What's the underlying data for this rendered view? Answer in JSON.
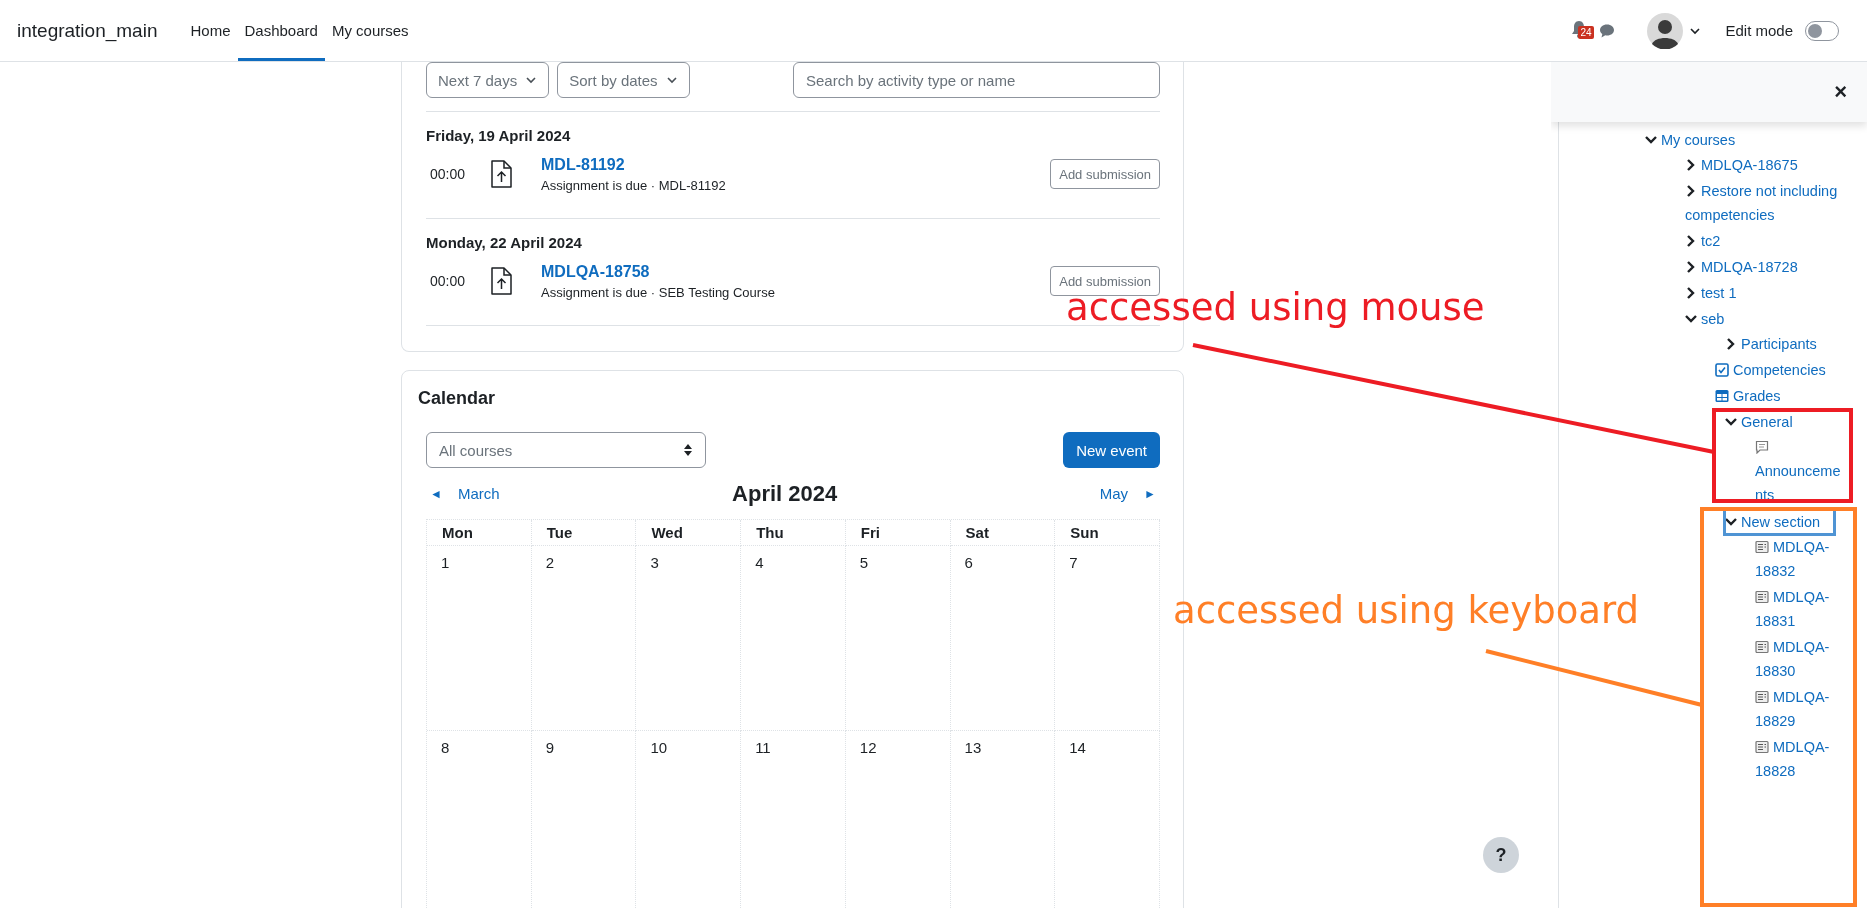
{
  "navbar": {
    "site_name": "integration_main",
    "items": [
      {
        "label": "Home",
        "selected": false
      },
      {
        "label": "Dashboard",
        "selected": true
      },
      {
        "label": "My courses",
        "selected": false
      }
    ],
    "notification_count": "24",
    "edit_mode": {
      "label": "Edit mode",
      "on": false
    }
  },
  "timeline": {
    "filters": [
      "Next 7 days",
      "Sort by dates"
    ],
    "search": {
      "placeholder": "Search by activity type or name"
    },
    "days": [
      {
        "date": "Friday, 19 April 2024",
        "events": [
          {
            "time": "00:00",
            "title": "MDL-81192",
            "subtitle": "Assignment is due · MDL-81192",
            "action": "Add submission"
          }
        ]
      },
      {
        "date": "Monday, 22 April 2024",
        "events": [
          {
            "time": "00:00",
            "title": "MDLQA-18758",
            "subtitle": "Assignment is due · SEB Testing Course",
            "action": "Add submission"
          }
        ]
      }
    ]
  },
  "calendar": {
    "title": "Calendar",
    "course_filter": "All courses",
    "new_event": "New event",
    "prev_arrow": "◄",
    "prev": "March",
    "month": "April 2024",
    "next": "May",
    "next_arrow": "►",
    "weekdays": [
      "Mon",
      "Tue",
      "Wed",
      "Thu",
      "Fri",
      "Sat",
      "Sun"
    ],
    "weeks": [
      [
        "1",
        "2",
        "3",
        "4",
        "5",
        "6",
        "7"
      ],
      [
        "8",
        "9",
        "10",
        "11",
        "12",
        "13",
        "14"
      ]
    ]
  },
  "drawer": {
    "close": "×",
    "tree": [
      {
        "label": "My courses",
        "kind": "folder",
        "expanded": true,
        "children": [
          {
            "label": "MDLQA-18675",
            "kind": "folder",
            "expanded": false
          },
          {
            "label": "Restore not including competencies",
            "kind": "folder",
            "expanded": false
          },
          {
            "label": "tc2",
            "kind": "folder",
            "expanded": false
          },
          {
            "label": "MDLQA-18728",
            "kind": "folder",
            "expanded": false
          },
          {
            "label": "test 1",
            "kind": "folder",
            "expanded": false
          },
          {
            "label": "seb",
            "kind": "folder",
            "expanded": true,
            "children": [
              {
                "label": "Participants",
                "kind": "folder",
                "expanded": false
              },
              {
                "label": "Competencies",
                "kind": "competencies"
              },
              {
                "label": "Grades",
                "kind": "grades"
              },
              {
                "label": "General",
                "kind": "folder",
                "expanded": true,
                "children": [
                  {
                    "label": "Announcements",
                    "kind": "forum"
                  }
                ]
              },
              {
                "label": "New section",
                "kind": "folder",
                "expanded": true,
                "focused": true,
                "children": [
                  {
                    "label": "MDLQA-18832",
                    "kind": "page"
                  },
                  {
                    "label": "MDLQA-18831",
                    "kind": "page"
                  },
                  {
                    "label": "MDLQA-18830",
                    "kind": "page"
                  },
                  {
                    "label": "MDLQA-18829",
                    "kind": "page"
                  },
                  {
                    "label": "MDLQA-18828",
                    "kind": "page"
                  }
                ]
              }
            ]
          }
        ]
      }
    ]
  },
  "annotations": [
    {
      "text": "accessed using mouse",
      "color": "#ed1c24"
    },
    {
      "text": "accessed using keyboard",
      "color": "#ff7f27"
    }
  ],
  "help_button": "?"
}
